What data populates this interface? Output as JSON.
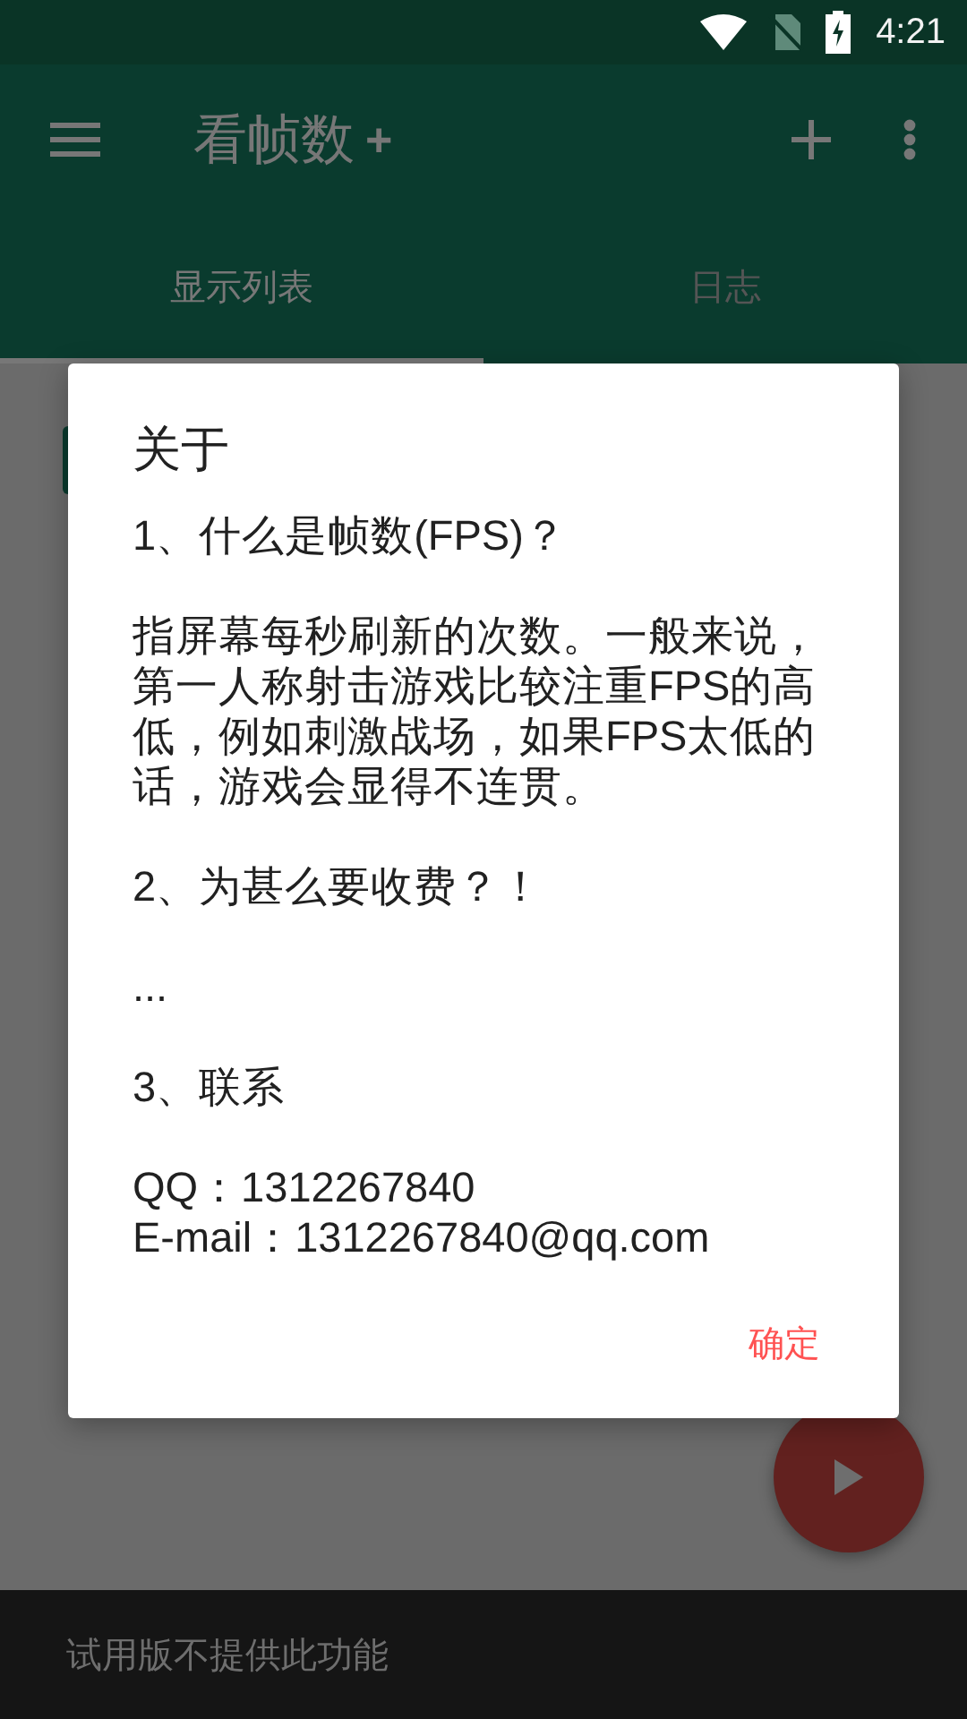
{
  "status_bar": {
    "time": "4:21"
  },
  "app_bar": {
    "title": "看帧数",
    "title_badge": "+"
  },
  "tabs": [
    {
      "label": "显示列表",
      "selected": true
    },
    {
      "label": "日志",
      "selected": false
    }
  ],
  "dialog": {
    "title": "关于",
    "paragraphs": [
      {
        "lines": [
          "1、什么是帧数(FPS)？"
        ]
      },
      {
        "lines": [
          "指屏幕每秒刷新的次数。一般来说，第一人称射击游戏比较注重FPS的高低，例如刺激战场，如果FPS太低的话，游戏会显得不连贯。"
        ]
      },
      {
        "lines": [
          "2、为甚么要收费？！"
        ]
      },
      {
        "lines": [
          "..."
        ]
      },
      {
        "lines": [
          "3、联系"
        ]
      },
      {
        "lines": [
          "QQ：1312267840",
          "E-mail：1312267840@qq.com"
        ]
      }
    ],
    "button": "确定"
  },
  "snackbar": {
    "message": "试用版不提供此功能"
  }
}
